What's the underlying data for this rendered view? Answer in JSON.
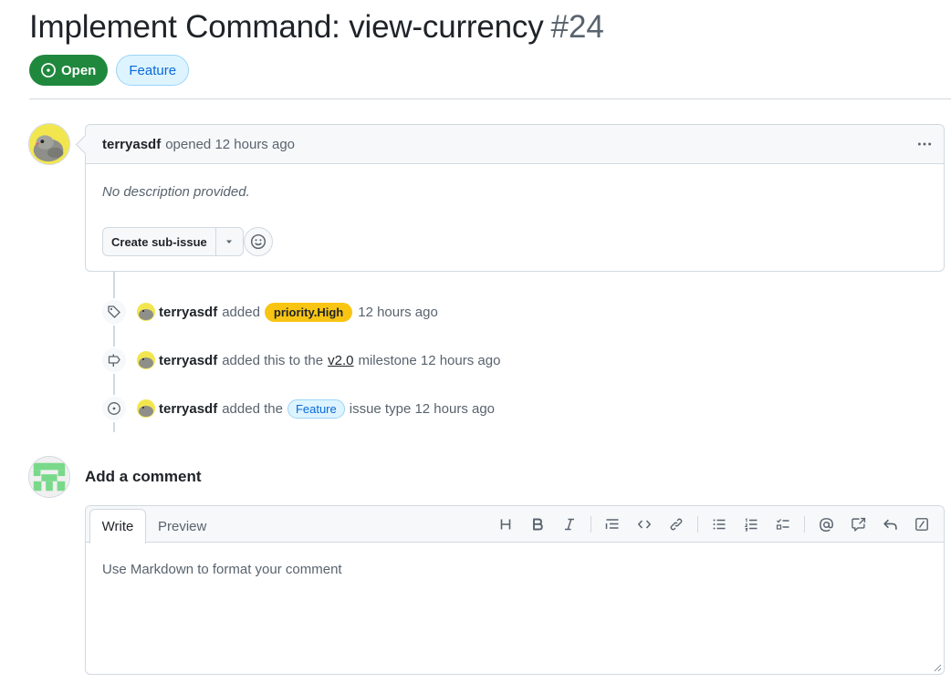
{
  "issue": {
    "title": "Implement Command: view-currency",
    "number": "#24",
    "state_label": "Open",
    "type_label": "Feature"
  },
  "comment": {
    "author": "terryasdf",
    "action": "opened",
    "time": "12 hours ago",
    "body_placeholder": "No description provided.",
    "sub_issue_label": "Create sub-issue"
  },
  "timeline": [
    {
      "author": "terryasdf",
      "pre": "added",
      "label": "priority.High",
      "post": "12 hours ago"
    },
    {
      "author": "terryasdf",
      "pre": "added this to the",
      "link": "v2.0",
      "post": "milestone 12 hours ago"
    },
    {
      "author": "terryasdf",
      "pre": "added the",
      "label": "Feature",
      "post": "issue type 12 hours ago"
    }
  ],
  "new_comment": {
    "title": "Add a comment",
    "tab_write": "Write",
    "tab_preview": "Preview",
    "placeholder": "Use Markdown to format your comment"
  },
  "colors": {
    "open_green": "#1f883d",
    "priority_yellow": "#f9c513",
    "feature_blue": "#0969da"
  },
  "icons": [
    "issue-opened-icon",
    "kebab-horizontal-icon",
    "triangle-down-icon",
    "smiley-icon",
    "tag-icon",
    "milestone-icon",
    "heading-icon",
    "bold-icon",
    "italic-icon",
    "quote-icon",
    "code-icon",
    "link-icon",
    "unordered-list-icon",
    "ordered-list-icon",
    "task-list-icon",
    "mention-icon",
    "cross-reference-icon",
    "reply-icon",
    "slash-command-icon"
  ]
}
